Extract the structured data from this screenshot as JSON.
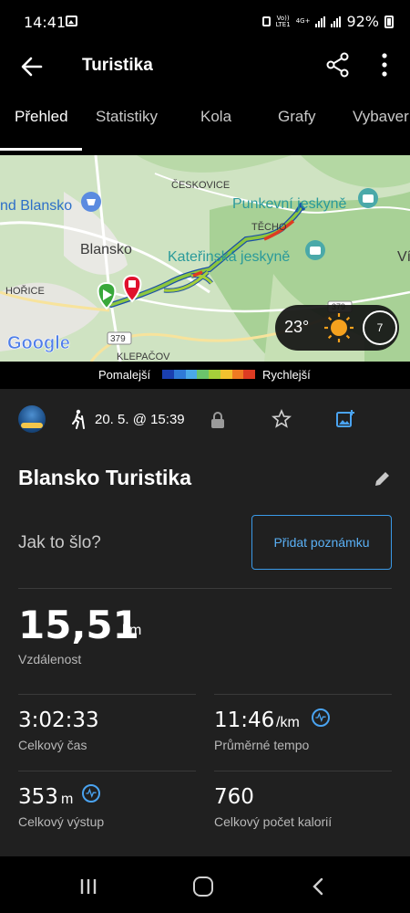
{
  "status_bar": {
    "time": "14:41",
    "network_top": "Vo))",
    "network_bottom": "LTE1",
    "lte_top": "4G+",
    "battery": "92%"
  },
  "app_bar": {
    "title": "Turistika"
  },
  "tabs": [
    {
      "label": "Přehled",
      "active": true
    },
    {
      "label": "Statistiky"
    },
    {
      "label": "Kola"
    },
    {
      "label": "Grafy"
    },
    {
      "label": "Vybaver"
    }
  ],
  "map": {
    "labels": {
      "blansko_poi": "nd Blansko",
      "ceskovice": "ČESKOVICE",
      "punkevni": "Punkevní jeskyně",
      "blansko": "Blansko",
      "techov": "TĚCHO",
      "katerinska": "Kateřinská jeskyně",
      "vi": "Ví",
      "horice": "HOŘICE",
      "road_379": "379",
      "road_379b": "379",
      "klepacov": "KLEPAČOV",
      "google": "Google"
    },
    "weather": {
      "temperature": "23°",
      "wind": "7"
    }
  },
  "legend": {
    "slow": "Pomalejší",
    "fast": "Rychlejší",
    "colors": [
      "#1a3fb0",
      "#2f7ad8",
      "#4aa9e8",
      "#6bc46b",
      "#a6cf3a",
      "#f2c12e",
      "#ef7a22",
      "#dd3b22"
    ]
  },
  "activity": {
    "date": "20. 5. @ 15:39",
    "name": "Blansko Turistika",
    "feel_prompt": "Jak to šlo?",
    "add_note": "Přidat poznámku"
  },
  "stats": {
    "distance": {
      "value": "15,51",
      "unit": "km",
      "label": "Vzdálenost"
    },
    "total_time": {
      "value": "3:02:33",
      "label": "Celkový čas"
    },
    "avg_pace": {
      "value": "11:46",
      "unit": "/km",
      "label": "Průměrné tempo"
    },
    "ascent": {
      "value": "353",
      "unit": "m",
      "label": "Celkový výstup"
    },
    "calories": {
      "value": "760",
      "label": "Celkový počet kalorií"
    }
  }
}
